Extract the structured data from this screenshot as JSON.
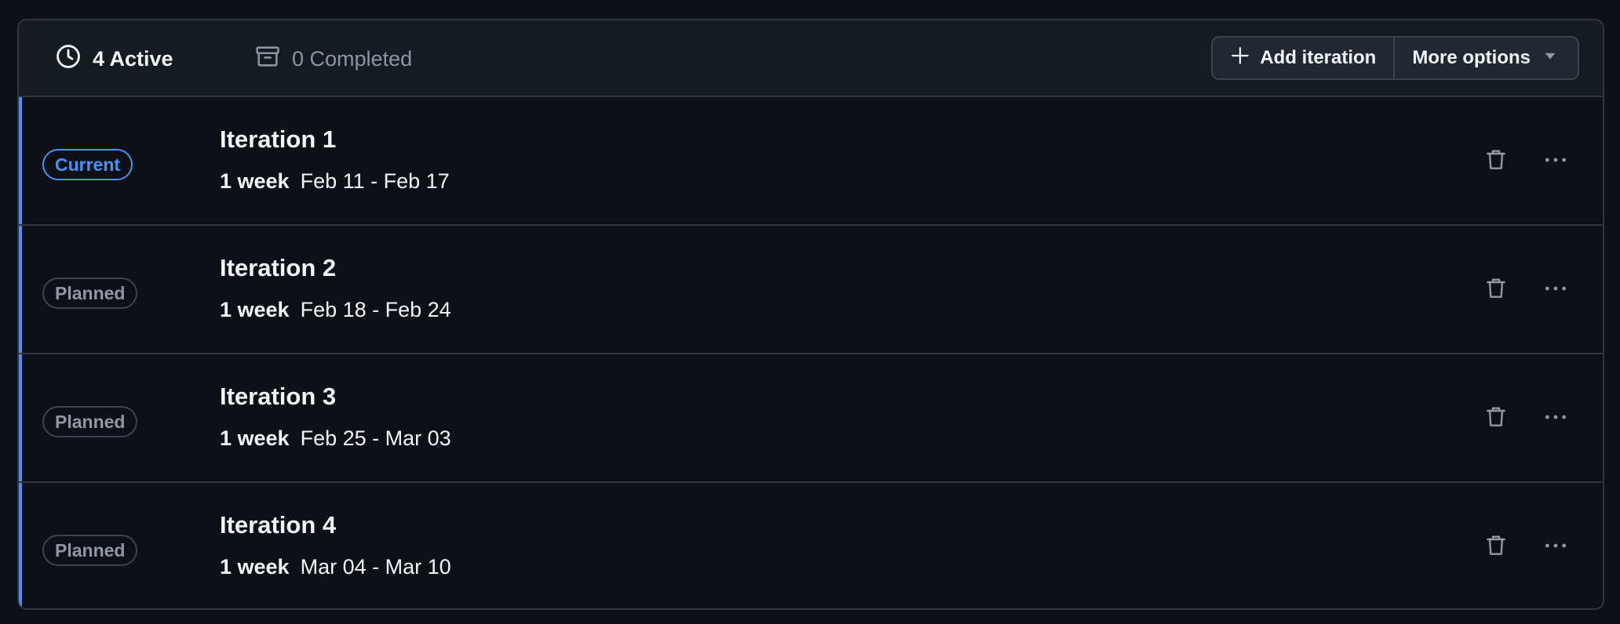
{
  "tabs": {
    "active_label": "4 Active",
    "completed_label": "0 Completed"
  },
  "toolbar": {
    "add_label": "Add iteration",
    "more_label": "More options"
  },
  "iterations": [
    {
      "status": "Current",
      "title": "Iteration 1",
      "duration": "1 week",
      "range": "Feb 11 - Feb 17"
    },
    {
      "status": "Planned",
      "title": "Iteration 2",
      "duration": "1 week",
      "range": "Feb 18 - Feb 24"
    },
    {
      "status": "Planned",
      "title": "Iteration 3",
      "duration": "1 week",
      "range": "Feb 25 - Mar 03"
    },
    {
      "status": "Planned",
      "title": "Iteration 4",
      "duration": "1 week",
      "range": "Mar 04 - Mar 10"
    }
  ],
  "colors": {
    "accent": "#4493f8",
    "background": "#0d1117",
    "header": "#161b22"
  },
  "icons": [
    "clock-icon",
    "archive-icon",
    "plus-icon",
    "triangle-down-icon",
    "trash-icon",
    "kebab-horizontal-icon"
  ]
}
